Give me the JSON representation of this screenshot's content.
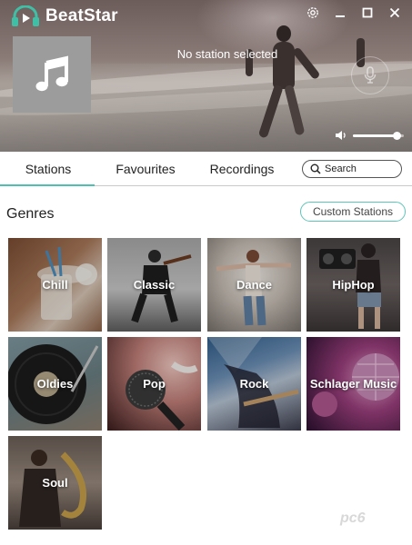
{
  "app": {
    "title": "BeatStar"
  },
  "player": {
    "now_playing": "No station selected",
    "volume": 0.85
  },
  "tabs": [
    {
      "label": "Stations",
      "active": true
    },
    {
      "label": "Favourites",
      "active": false
    },
    {
      "label": "Recordings",
      "active": false
    }
  ],
  "search": {
    "placeholder": "Search"
  },
  "genres": {
    "heading": "Genres",
    "custom_button": "Custom Stations",
    "items": [
      "Chill",
      "Classic",
      "Dance",
      "HipHop",
      "Oldies",
      "Pop",
      "Rock",
      "Schlager Music",
      "Soul"
    ]
  },
  "colors": {
    "accent": "#4fbfb1"
  },
  "watermark": "pc6"
}
